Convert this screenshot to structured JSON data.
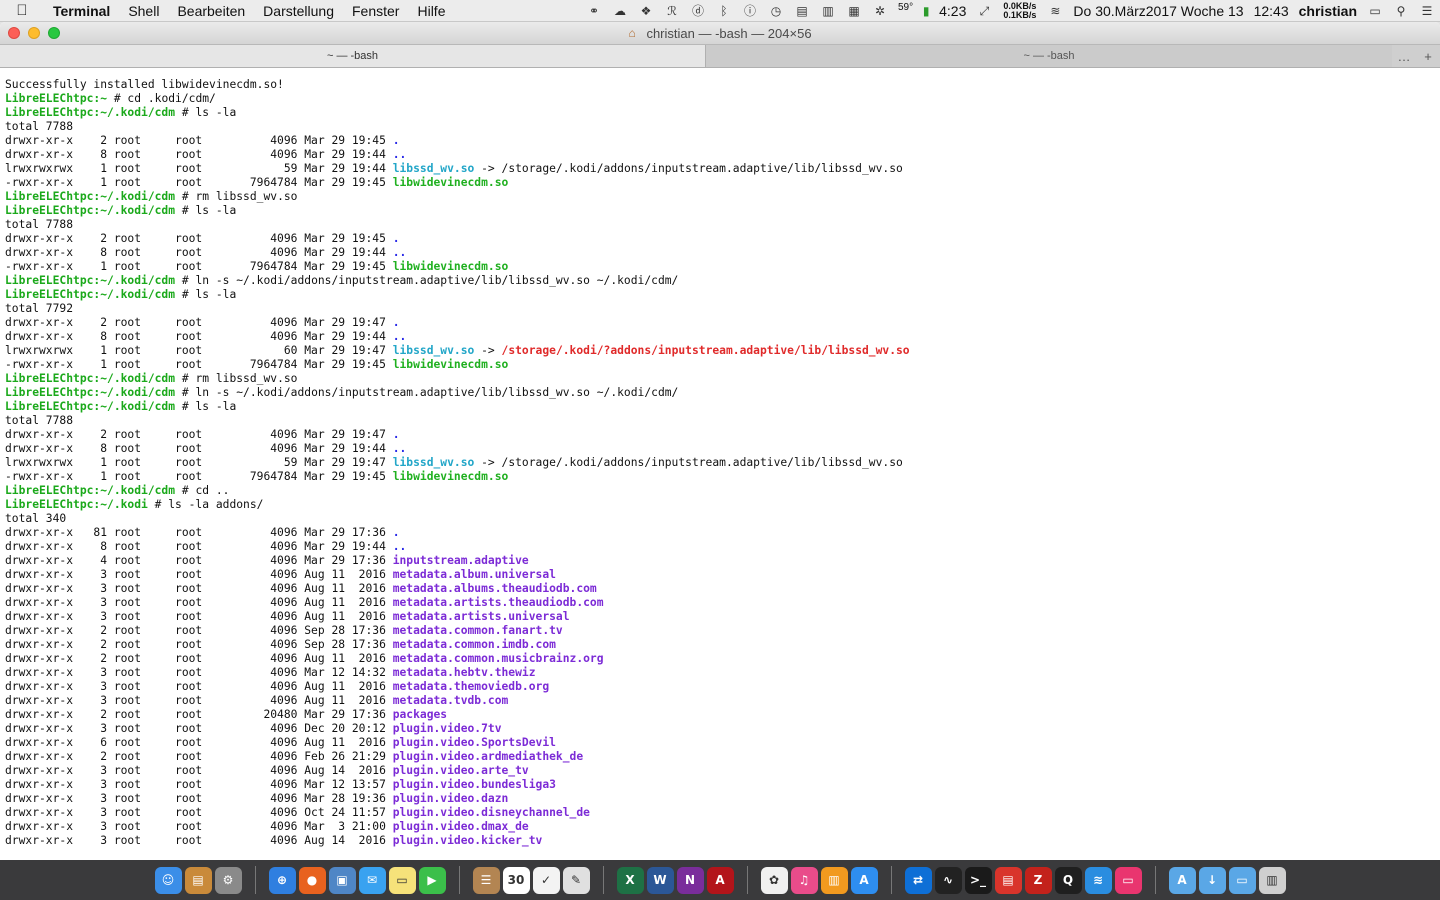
{
  "menubar": {
    "items": [
      "Terminal",
      "Shell",
      "Bearbeiten",
      "Darstellung",
      "Fenster",
      "Hilfe"
    ],
    "temp": "59°",
    "battery_time": "4:23",
    "net_up": "0.0KB/s",
    "net_down": "0.1KB/s",
    "date": "Do 30.März2017 Woche 13",
    "time": "12:43",
    "user": "christian"
  },
  "window": {
    "title": "christian — -bash — 204×56",
    "tabs": [
      {
        "label": "~ — -bash",
        "active": true
      },
      {
        "label": "~ — -bash",
        "active": false
      }
    ]
  },
  "terminal": {
    "lines": [
      [
        [
          "Successfully installed libwidevinecdm.so!",
          ""
        ]
      ],
      [
        [
          "LibreELEChtpc:~",
          "p"
        ],
        [
          " # cd .kodi/cdm/",
          ""
        ]
      ],
      [
        [
          "LibreELEChtpc:~/.kodi/cdm",
          "p"
        ],
        [
          " # ls -la",
          ""
        ]
      ],
      [
        [
          "total 7788",
          ""
        ]
      ],
      [
        [
          "drwxr-xr-x    2 root     root          4096 Mar 29 19:45 ",
          ""
        ],
        [
          ".",
          "d"
        ]
      ],
      [
        [
          "drwxr-xr-x    8 root     root          4096 Mar 29 19:44 ",
          ""
        ],
        [
          "..",
          "d"
        ]
      ],
      [
        [
          "lrwxrwxrwx    1 root     root            59 Mar 29 19:44 ",
          ""
        ],
        [
          "libssd_wv.so",
          "lnk"
        ],
        [
          " -> /storage/.kodi/addons/inputstream.adaptive/lib/libssd_wv.so",
          ""
        ]
      ],
      [
        [
          "-rwxr-xr-x    1 root     root       7964784 Mar 29 19:45 ",
          ""
        ],
        [
          "libwidevinecdm.so",
          "exe"
        ]
      ],
      [
        [
          "LibreELEChtpc:~/.kodi/cdm",
          "p"
        ],
        [
          " # rm libssd_wv.so",
          ""
        ]
      ],
      [
        [
          "LibreELEChtpc:~/.kodi/cdm",
          "p"
        ],
        [
          " # ls -la",
          ""
        ]
      ],
      [
        [
          "total 7788",
          ""
        ]
      ],
      [
        [
          "drwxr-xr-x    2 root     root          4096 Mar 29 19:45 ",
          ""
        ],
        [
          ".",
          "d"
        ]
      ],
      [
        [
          "drwxr-xr-x    8 root     root          4096 Mar 29 19:44 ",
          ""
        ],
        [
          "..",
          "d"
        ]
      ],
      [
        [
          "-rwxr-xr-x    1 root     root       7964784 Mar 29 19:45 ",
          ""
        ],
        [
          "libwidevinecdm.so",
          "exe"
        ]
      ],
      [
        [
          "LibreELEChtpc:~/.kodi/cdm",
          "p"
        ],
        [
          " # ln -s ~/.kodi/addons/inputstream.adaptive/lib/libssd_wv.so ~/.kodi/cdm/",
          ""
        ]
      ],
      [
        [
          "LibreELEChtpc:~/.kodi/cdm",
          "p"
        ],
        [
          " # ls -la",
          ""
        ]
      ],
      [
        [
          "total 7792",
          ""
        ]
      ],
      [
        [
          "drwxr-xr-x    2 root     root          4096 Mar 29 19:47 ",
          ""
        ],
        [
          ".",
          "d"
        ]
      ],
      [
        [
          "drwxr-xr-x    8 root     root          4096 Mar 29 19:44 ",
          ""
        ],
        [
          "..",
          "d"
        ]
      ],
      [
        [
          "lrwxrwxrwx    1 root     root            60 Mar 29 19:47 ",
          ""
        ],
        [
          "libssd_wv.so",
          "lnk"
        ],
        [
          " -> ",
          ""
        ],
        [
          "/storage/.kodi/?addons/inputstream.adaptive/lib/libssd_wv.so",
          "broken"
        ]
      ],
      [
        [
          "-rwxr-xr-x    1 root     root       7964784 Mar 29 19:45 ",
          ""
        ],
        [
          "libwidevinecdm.so",
          "exe"
        ]
      ],
      [
        [
          "LibreELEChtpc:~/.kodi/cdm",
          "p"
        ],
        [
          " # rm libssd_wv.so",
          ""
        ]
      ],
      [
        [
          "LibreELEChtpc:~/.kodi/cdm",
          "p"
        ],
        [
          " # ln -s ~/.kodi/addons/inputstream.adaptive/lib/libssd_wv.so ~/.kodi/cdm/",
          ""
        ]
      ],
      [
        [
          "LibreELEChtpc:~/.kodi/cdm",
          "p"
        ],
        [
          " # ls -la",
          ""
        ]
      ],
      [
        [
          "total 7788",
          ""
        ]
      ],
      [
        [
          "drwxr-xr-x    2 root     root          4096 Mar 29 19:47 ",
          ""
        ],
        [
          ".",
          "d"
        ]
      ],
      [
        [
          "drwxr-xr-x    8 root     root          4096 Mar 29 19:44 ",
          ""
        ],
        [
          "..",
          "d"
        ]
      ],
      [
        [
          "lrwxrwxrwx    1 root     root            59 Mar 29 19:47 ",
          ""
        ],
        [
          "libssd_wv.so",
          "lnk"
        ],
        [
          " -> /storage/.kodi/addons/inputstream.adaptive/lib/libssd_wv.so",
          ""
        ]
      ],
      [
        [
          "-rwxr-xr-x    1 root     root       7964784 Mar 29 19:45 ",
          ""
        ],
        [
          "libwidevinecdm.so",
          "exe"
        ]
      ],
      [
        [
          "LibreELEChtpc:~/.kodi/cdm",
          "p"
        ],
        [
          " # cd ..",
          ""
        ]
      ],
      [
        [
          "LibreELEChtpc:~/.kodi",
          "p"
        ],
        [
          " # ls -la addons/",
          ""
        ]
      ],
      [
        [
          "total 340",
          ""
        ]
      ],
      [
        [
          "drwxr-xr-x   81 root     root          4096 Mar 29 17:36 ",
          ""
        ],
        [
          ".",
          "d"
        ]
      ],
      [
        [
          "drwxr-xr-x    8 root     root          4096 Mar 29 19:44 ",
          ""
        ],
        [
          "..",
          "d"
        ]
      ],
      [
        [
          "drwxr-xr-x    4 root     root          4096 Mar 29 17:36 ",
          ""
        ],
        [
          "inputstream.adaptive",
          "dir"
        ]
      ],
      [
        [
          "drwxr-xr-x    3 root     root          4096 Aug 11  2016 ",
          ""
        ],
        [
          "metadata.album.universal",
          "dir"
        ]
      ],
      [
        [
          "drwxr-xr-x    3 root     root          4096 Aug 11  2016 ",
          ""
        ],
        [
          "metadata.albums.theaudiodb.com",
          "dir"
        ]
      ],
      [
        [
          "drwxr-xr-x    3 root     root          4096 Aug 11  2016 ",
          ""
        ],
        [
          "metadata.artists.theaudiodb.com",
          "dir"
        ]
      ],
      [
        [
          "drwxr-xr-x    3 root     root          4096 Aug 11  2016 ",
          ""
        ],
        [
          "metadata.artists.universal",
          "dir"
        ]
      ],
      [
        [
          "drwxr-xr-x    2 root     root          4096 Sep 28 17:36 ",
          ""
        ],
        [
          "metadata.common.fanart.tv",
          "dir"
        ]
      ],
      [
        [
          "drwxr-xr-x    2 root     root          4096 Sep 28 17:36 ",
          ""
        ],
        [
          "metadata.common.imdb.com",
          "dir"
        ]
      ],
      [
        [
          "drwxr-xr-x    2 root     root          4096 Aug 11  2016 ",
          ""
        ],
        [
          "metadata.common.musicbrainz.org",
          "dir"
        ]
      ],
      [
        [
          "drwxr-xr-x    3 root     root          4096 Mar 12 14:32 ",
          ""
        ],
        [
          "metadata.hebtv.thewiz",
          "dir"
        ]
      ],
      [
        [
          "drwxr-xr-x    3 root     root          4096 Aug 11  2016 ",
          ""
        ],
        [
          "metadata.themoviedb.org",
          "dir"
        ]
      ],
      [
        [
          "drwxr-xr-x    3 root     root          4096 Aug 11  2016 ",
          ""
        ],
        [
          "metadata.tvdb.com",
          "dir"
        ]
      ],
      [
        [
          "drwxr-xr-x    2 root     root         20480 Mar 29 17:36 ",
          ""
        ],
        [
          "packages",
          "dir"
        ]
      ],
      [
        [
          "drwxr-xr-x    3 root     root          4096 Dec 20 20:12 ",
          ""
        ],
        [
          "plugin.video.7tv",
          "dir"
        ]
      ],
      [
        [
          "drwxr-xr-x    6 root     root          4096 Aug 11  2016 ",
          ""
        ],
        [
          "plugin.video.SportsDevil",
          "dir"
        ]
      ],
      [
        [
          "drwxr-xr-x    2 root     root          4096 Feb 26 21:29 ",
          ""
        ],
        [
          "plugin.video.ardmediathek_de",
          "dir"
        ]
      ],
      [
        [
          "drwxr-xr-x    3 root     root          4096 Aug 14  2016 ",
          ""
        ],
        [
          "plugin.video.arte_tv",
          "dir"
        ]
      ],
      [
        [
          "drwxr-xr-x    3 root     root          4096 Mar 12 13:57 ",
          ""
        ],
        [
          "plugin.video.bundesliga3",
          "dir"
        ]
      ],
      [
        [
          "drwxr-xr-x    3 root     root          4096 Mar 28 19:36 ",
          ""
        ],
        [
          "plugin.video.dazn",
          "dir"
        ]
      ],
      [
        [
          "drwxr-xr-x    3 root     root          4096 Oct 24 11:57 ",
          ""
        ],
        [
          "plugin.video.disneychannel_de",
          "dir"
        ]
      ],
      [
        [
          "drwxr-xr-x    3 root     root          4096 Mar  3 21:00 ",
          ""
        ],
        [
          "plugin.video.dmax_de",
          "dir"
        ]
      ],
      [
        [
          "drwxr-xr-x    3 root     root          4096 Aug 14  2016 ",
          ""
        ],
        [
          "plugin.video.kicker_tv",
          "dir"
        ]
      ]
    ]
  },
  "dock": {
    "apps": [
      {
        "name": "finder-icon",
        "color": "#3b8ee8",
        "glyph": "☺"
      },
      {
        "name": "notes-icon",
        "color": "#c98a3a",
        "glyph": "▤"
      },
      {
        "name": "system-preferences-icon",
        "color": "#8a8a8a",
        "glyph": "⚙"
      },
      {
        "name": "sep"
      },
      {
        "name": "safari-icon",
        "color": "#2f7fe0",
        "glyph": "⊕"
      },
      {
        "name": "firefox-icon",
        "color": "#e8621f",
        "glyph": "●"
      },
      {
        "name": "preview-icon",
        "color": "#4f86c6",
        "glyph": "▣"
      },
      {
        "name": "messages-icon",
        "color": "#39a2f0",
        "glyph": "✉"
      },
      {
        "name": "stickies-icon",
        "color": "#f6e27a",
        "glyph": "▭"
      },
      {
        "name": "facetime-icon",
        "color": "#3bbf4a",
        "glyph": "▶"
      },
      {
        "name": "sep"
      },
      {
        "name": "contacts-icon",
        "color": "#b38552",
        "glyph": "☰"
      },
      {
        "name": "calendar-icon",
        "color": "#ffffff",
        "glyph": "30"
      },
      {
        "name": "reminders-icon",
        "color": "#f3f3f3",
        "glyph": "✓"
      },
      {
        "name": "photos-app-icon",
        "color": "#e0e0e0",
        "glyph": "✎"
      },
      {
        "name": "sep"
      },
      {
        "name": "excel-icon",
        "color": "#1e7145",
        "glyph": "X"
      },
      {
        "name": "word-icon",
        "color": "#2b5797",
        "glyph": "W"
      },
      {
        "name": "onenote-icon",
        "color": "#7a2d9b",
        "glyph": "N"
      },
      {
        "name": "acrobat-icon",
        "color": "#b3141a",
        "glyph": "A"
      },
      {
        "name": "sep"
      },
      {
        "name": "photos-icon",
        "color": "#f0f0f0",
        "glyph": "✿"
      },
      {
        "name": "itunes-icon",
        "color": "#e94c8a",
        "glyph": "♫"
      },
      {
        "name": "ibooks-icon",
        "color": "#f29a1f",
        "glyph": "▥"
      },
      {
        "name": "app-store-icon",
        "color": "#2e8ef0",
        "glyph": "A"
      },
      {
        "name": "sep"
      },
      {
        "name": "teamviewer-icon",
        "color": "#0e6fd6",
        "glyph": "⇄"
      },
      {
        "name": "activity-monitor-icon",
        "color": "#222222",
        "glyph": "∿"
      },
      {
        "name": "terminal-icon",
        "color": "#1a1a1a",
        "glyph": ">_"
      },
      {
        "name": "toolbox-icon",
        "color": "#d9342b",
        "glyph": "▤"
      },
      {
        "name": "filezilla-icon",
        "color": "#c3221b",
        "glyph": "Z"
      },
      {
        "name": "quicktime-icon",
        "color": "#1f1f1f",
        "glyph": "Q"
      },
      {
        "name": "wifi-explorer-icon",
        "color": "#2a8de0",
        "glyph": "≋"
      },
      {
        "name": "display-icon",
        "color": "#e9356f",
        "glyph": "▭"
      },
      {
        "name": "sep"
      },
      {
        "name": "applications-folder-icon",
        "color": "#5aa7e6",
        "glyph": "A"
      },
      {
        "name": "downloads-folder-icon",
        "color": "#5aa7e6",
        "glyph": "↓"
      },
      {
        "name": "documents-folder-icon",
        "color": "#5aa7e6",
        "glyph": "▭"
      },
      {
        "name": "trash-icon",
        "color": "#cfcfcf",
        "glyph": "▥"
      }
    ]
  }
}
